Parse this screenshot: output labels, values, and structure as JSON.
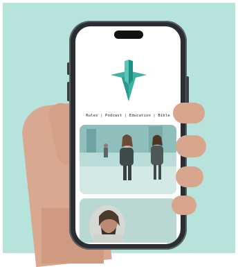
{
  "nav": {
    "items": [
      "Rules",
      "Podcast",
      "Education",
      "Bible"
    ],
    "separator": "|"
  },
  "colors": {
    "background": "#b7e3dd",
    "accent": "#3fb3a3",
    "accent_dark": "#1f8f80"
  }
}
